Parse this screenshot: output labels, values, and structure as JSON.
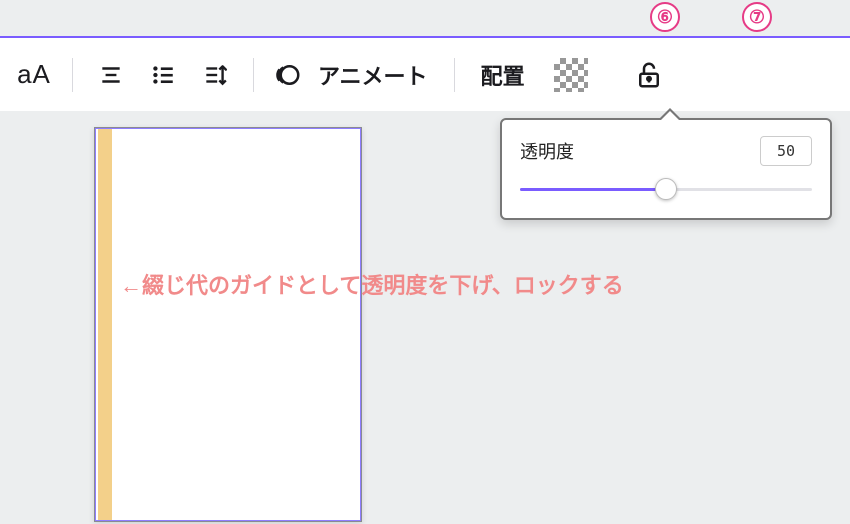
{
  "badges": {
    "step6": "⑥",
    "step7": "⑦"
  },
  "toolbar": {
    "typography_label": "aA",
    "animate_label": "アニメート",
    "position_label": "配置"
  },
  "popover": {
    "label": "透明度",
    "value": "50",
    "slider_percent": 50
  },
  "annotation": {
    "text": "←綴じ代のガイドとして透明度を下げ、ロックする"
  },
  "colors": {
    "accent": "#7a5cff",
    "annotation": "#f18a8a",
    "badge": "#E63B86",
    "gutter": "#f3d08a"
  }
}
